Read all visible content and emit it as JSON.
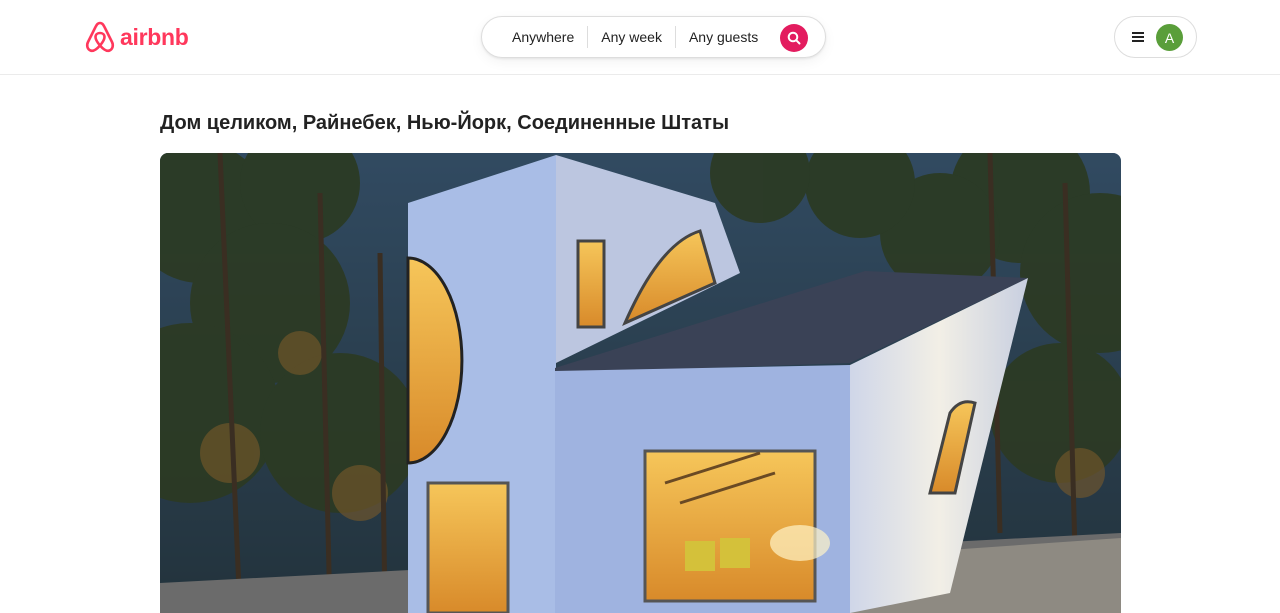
{
  "header": {
    "logo_text": "airbnb",
    "search": {
      "where_label": "Anywhere",
      "when_label": "Any week",
      "who_label": "Any guests"
    },
    "user_menu": {
      "avatar_initial": "A"
    }
  },
  "listing": {
    "title": "Дом целиком, Райнебек, Нью-Йорк, Соединенные Штаты"
  },
  "colors": {
    "brand": "#ff385c",
    "search_button": "#e31c5f",
    "avatar": "#5a9e3a"
  },
  "icons": [
    "airbnb-logo-icon",
    "search-icon",
    "hamburger-menu-icon"
  ]
}
